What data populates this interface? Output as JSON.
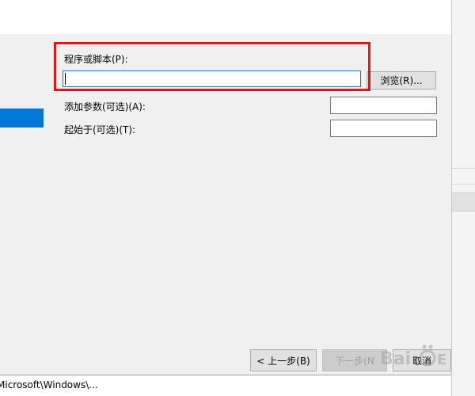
{
  "form": {
    "program_label": "程序或脚本(P):",
    "program_value": "",
    "browse_button": "浏览(R)...",
    "args_label": "添加参数(可选)(A):",
    "args_value": "",
    "start_in_label": "起始于(可选)(T):",
    "start_in_value": ""
  },
  "footer": {
    "back_button": "< 上一步(B)",
    "next_button": "下一步(N",
    "cancel_button": "取消"
  },
  "status_bar": {
    "path_text": "Microsoft\\Windows\\..."
  },
  "colors": {
    "highlight": "#e0151c",
    "selection": "#0078d7"
  }
}
